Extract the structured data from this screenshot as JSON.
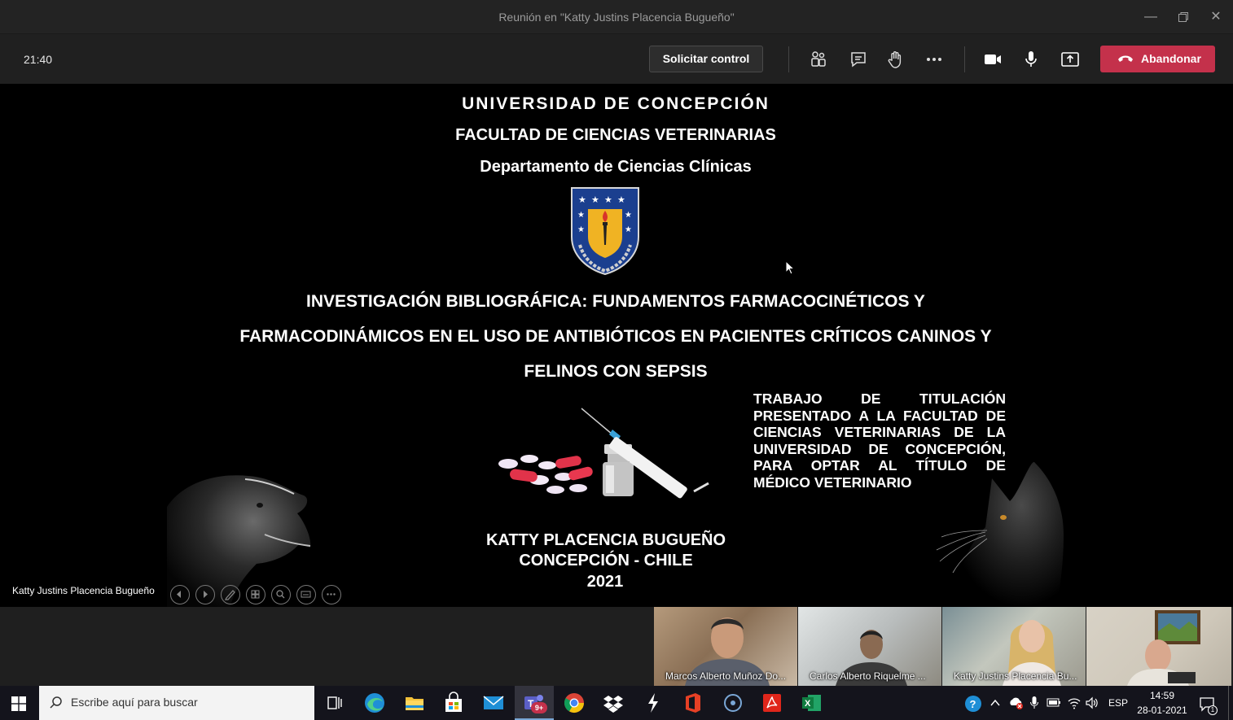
{
  "window": {
    "title": "Reunión en \"Katty Justins Placencia Bugueño\""
  },
  "toolbar": {
    "clock": "21:40",
    "request_control_label": "Solicitar control",
    "leave_label": "Abandonar"
  },
  "slide": {
    "university": "UNIVERSIDAD DE CONCEPCIÓN",
    "faculty": "FACULTAD DE CIENCIAS VETERINARIAS",
    "department": "Departamento de Ciencias Clínicas",
    "title_line1": "INVESTIGACIÓN BIBLIOGRÁFICA: FUNDAMENTOS FARMACOCINÉTICOS Y",
    "title_line2": "FARMACODINÁMICOS EN EL USO DE ANTIBIÓTICOS EN PACIENTES CRÍTICOS CANINOS Y",
    "title_line3": "FELINOS CON SEPSIS",
    "thesis_lines": [
      "TRABAJO DE TITULACIÓN",
      "PRESENTADO A LA FACULTAD DE",
      "CIENCIAS VETERINARIAS DE LA",
      "UNIVERSIDAD DE CONCEPCIÓN,",
      "PARA OPTAR AL TÍTULO DE",
      "MÉDICO VETERINARIO"
    ],
    "author": "KATTY PLACENCIA BUGUEÑO",
    "location": "CONCEPCIÓN - CHILE",
    "year": "2021"
  },
  "presenter_label": "Katty Justins Placencia Bugueño",
  "participants": [
    {
      "name": "Marcos Alberto Muñoz Do..."
    },
    {
      "name": "Carlos Alberto Riquelme ..."
    },
    {
      "name": "Katty Justins Placencia Bu..."
    }
  ],
  "taskbar": {
    "search_placeholder": "Escribe aquí para buscar",
    "teams_badge": "9+",
    "language": "ESP",
    "time": "14:59",
    "date": "28-01-2021",
    "notification_count": "1"
  }
}
